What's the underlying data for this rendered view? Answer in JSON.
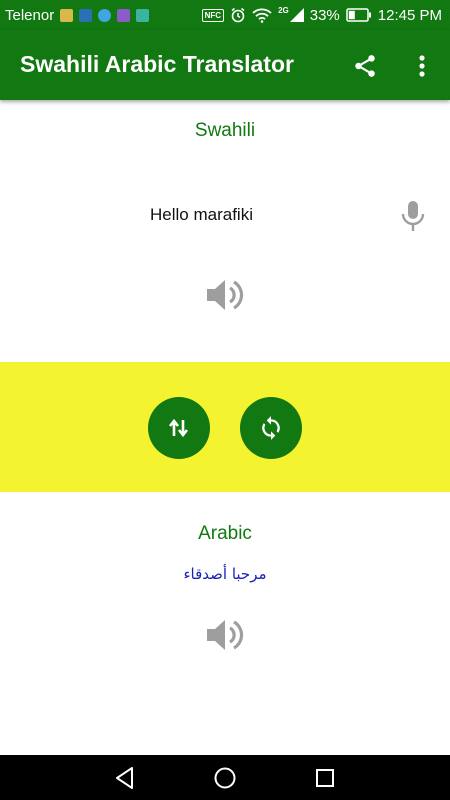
{
  "status_bar": {
    "carrier": "Telenor",
    "network": "2G",
    "battery": "33%",
    "time": "12:45 PM",
    "nfc": "NFC",
    "icons": [
      "cleaner-icon",
      "notification-icon",
      "message-icon",
      "gallery-icon",
      "download-icon",
      "nfc-icon",
      "alarm-icon",
      "wifi-icon",
      "signal-icon",
      "battery-icon"
    ]
  },
  "app_bar": {
    "title": "Swahili Arabic Translator",
    "actions": [
      "share-icon",
      "more-vert-icon"
    ]
  },
  "source": {
    "language": "Swahili",
    "text": "Hello marafiki"
  },
  "target": {
    "language": "Arabic",
    "text": "مرحبا أصدقاء"
  },
  "actions": {
    "swap": "swap-vert-icon",
    "refresh": "refresh-icon"
  },
  "colors": {
    "primary": "#127812",
    "band": "#f4f330",
    "translated_text": "#1a22b8",
    "icon_gray": "#9e9e9e"
  }
}
